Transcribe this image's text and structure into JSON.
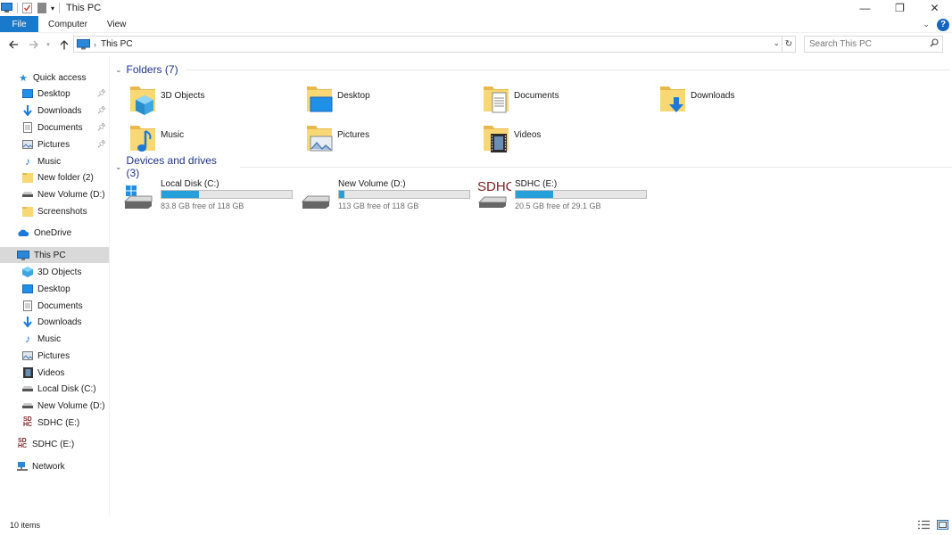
{
  "window": {
    "title": "This PC",
    "controls": {
      "minimize": "—",
      "restore": "❐",
      "close": "✕"
    }
  },
  "ribbon": {
    "tabs": [
      "File",
      "Computer",
      "View"
    ],
    "help": "?"
  },
  "address": {
    "crumb": "This PC",
    "search_placeholder": "Search This PC"
  },
  "sidebar": {
    "quick_access": {
      "label": "Quick access",
      "items": [
        {
          "label": "Desktop",
          "icon": "desktop-icon",
          "pinned": true
        },
        {
          "label": "Downloads",
          "icon": "download-arrow-icon",
          "pinned": true
        },
        {
          "label": "Documents",
          "icon": "document-icon",
          "pinned": true
        },
        {
          "label": "Pictures",
          "icon": "picture-icon",
          "pinned": true
        },
        {
          "label": "Music",
          "icon": "music-note-icon",
          "pinned": false
        },
        {
          "label": "New folder (2)",
          "icon": "folder-icon",
          "pinned": false
        },
        {
          "label": "New Volume (D:)",
          "icon": "drive-icon",
          "pinned": false
        },
        {
          "label": "Screenshots",
          "icon": "folder-icon",
          "pinned": false
        }
      ]
    },
    "onedrive": {
      "label": "OneDrive",
      "icon": "cloud-icon"
    },
    "this_pc": {
      "label": "This PC",
      "items": [
        {
          "label": "3D Objects",
          "icon": "cube-icon"
        },
        {
          "label": "Desktop",
          "icon": "desktop-icon"
        },
        {
          "label": "Documents",
          "icon": "document-icon"
        },
        {
          "label": "Downloads",
          "icon": "download-arrow-icon"
        },
        {
          "label": "Music",
          "icon": "music-note-icon"
        },
        {
          "label": "Pictures",
          "icon": "picture-icon"
        },
        {
          "label": "Videos",
          "icon": "film-icon"
        },
        {
          "label": "Local Disk (C:)",
          "icon": "drive-icon"
        },
        {
          "label": "New Volume (D:)",
          "icon": "drive-icon"
        },
        {
          "label": "SDHC (E:)",
          "icon": "sdhc-icon"
        }
      ]
    },
    "sdhc": {
      "label": "SDHC (E:)",
      "icon": "sdhc-icon"
    },
    "network": {
      "label": "Network",
      "icon": "network-icon"
    }
  },
  "main": {
    "folders_heading": "Folders (7)",
    "folders": [
      {
        "name": "3D Objects",
        "overlay": "cube-icon"
      },
      {
        "name": "Desktop",
        "overlay": "desktop-icon"
      },
      {
        "name": "Documents",
        "overlay": "document-icon"
      },
      {
        "name": "Downloads",
        "overlay": "download-arrow-icon"
      },
      {
        "name": "Music",
        "overlay": "music-note-icon"
      },
      {
        "name": "Pictures",
        "overlay": "picture-icon"
      },
      {
        "name": "Videos",
        "overlay": "film-icon"
      }
    ],
    "drives_heading": "Devices and drives (3)",
    "drives": [
      {
        "name": "Local Disk (C:)",
        "free_text": "83.8 GB free of 118 GB",
        "used_fraction": 0.29,
        "icon": "windows-drive-icon"
      },
      {
        "name": "New Volume (D:)",
        "free_text": "113 GB free of 118 GB",
        "used_fraction": 0.04,
        "icon": "drive-icon"
      },
      {
        "name": "SDHC (E:)",
        "free_text": "20.5 GB free of 29.1 GB",
        "used_fraction": 0.29,
        "icon": "sdhc-icon",
        "badge": "SDHC"
      }
    ]
  },
  "status": {
    "count": "10 items"
  },
  "colors": {
    "accent": "#1979ca",
    "bar": "#26a0da",
    "heading": "#1e3287"
  }
}
